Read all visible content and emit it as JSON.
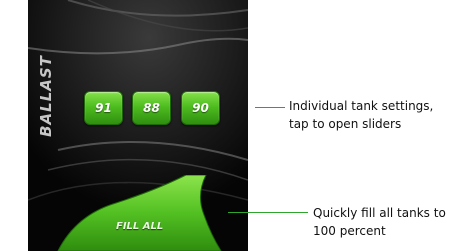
{
  "ballast": {
    "label": "BALLAST",
    "tanks": [
      "91",
      "88",
      "90"
    ]
  },
  "fill_all": {
    "label": "FILL ALL"
  },
  "callouts": {
    "tanks": "Individual tank settings, tap to open sliders",
    "fill_all": "Quickly fill all tanks to 100 percent"
  },
  "colors": {
    "accent": "#4ebd1f",
    "callout_line": "#2fa52c",
    "background": "#070707"
  }
}
